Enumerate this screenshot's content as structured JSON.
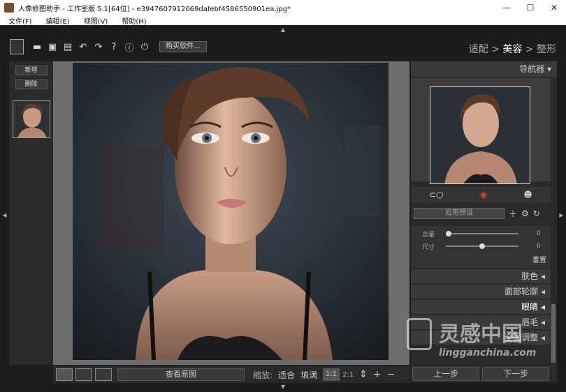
{
  "window": {
    "title": "人像修图助手 - 工作室版 5.1[64位] - e3947607912069dafebf4586550901ea.jpg*",
    "controls": [
      "—",
      "☐",
      "✕"
    ]
  },
  "menu": [
    "文件(F)",
    "编辑(E)",
    "视图(V)",
    "帮助(H)"
  ],
  "toolbar": {
    "buy_label": "购买软件...",
    "icons": [
      "open-icon",
      "save-icon",
      "save-as-icon",
      "undo-icon",
      "redo-icon",
      "help-icon",
      "info-icon",
      "plugin-icon"
    ]
  },
  "breadcrumb": {
    "step1": "适配",
    "sep1": " > ",
    "step2": "美容",
    "sep2": " > ",
    "step3": "整形"
  },
  "left_panel": {
    "new_label": "新增",
    "delete_label": "删除"
  },
  "bottom": {
    "compare_label": "查看原图",
    "zoom_label": "缩放:",
    "fit_label": "适合",
    "fill_label": "填满",
    "one_to_one": "1:1",
    "two_to_one": "2:1"
  },
  "right_panel": {
    "navigator_label": "导航器 ▾",
    "preset_label": "应用预设",
    "sliders": [
      {
        "label": "总量",
        "value": "0",
        "level": 0.0
      },
      {
        "label": "尺寸",
        "value": "0",
        "level": 0.5
      }
    ],
    "reset_label": "重置",
    "sections": [
      {
        "label": "肤色 ◂",
        "active": false
      },
      {
        "label": "面部轮廓 ◂",
        "active": false
      },
      {
        "label": "眼睛 ◂",
        "active": true
      },
      {
        "label": "眉毛 ◂",
        "active": false
      },
      {
        "label": "全图调整 ◂",
        "active": false
      }
    ],
    "prev_label": "上一步",
    "next_label": "下一步"
  },
  "watermark": {
    "cn": "灵感中国",
    "url": "lingganchina.com"
  }
}
